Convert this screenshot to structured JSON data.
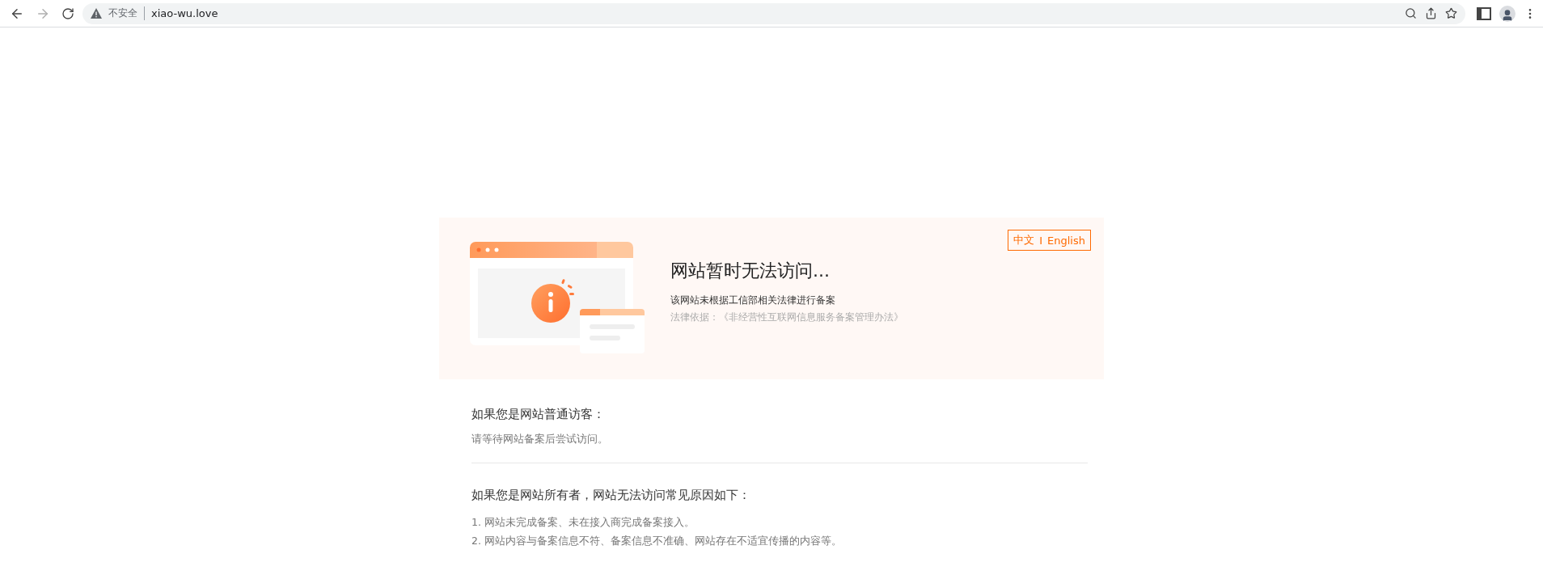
{
  "browser": {
    "security_label": "不安全",
    "url": "xiao-wu.love"
  },
  "notice": {
    "language_switch": {
      "options": [
        "中文",
        "English"
      ],
      "separator": "I"
    },
    "title": "网站暂时无法访问...",
    "reason": "该网站未根据工信部相关法律进行备案",
    "legal_basis": "法律依据：《非经营性互联网信息服务备案管理办法》"
  },
  "sections": [
    {
      "heading": "如果您是网站普通访客：",
      "items": [
        {
          "kind": "plain",
          "text": "请等待网站备案后尝试访问。"
        }
      ]
    },
    {
      "heading": "如果您是网站所有者，网站无法访问常见原因如下：",
      "items": [
        {
          "kind": "numbered",
          "text": "1. 网站未完成备案、未在接入商完成备案接入。"
        },
        {
          "kind": "numbered",
          "text": "2. 网站内容与备案信息不符、备案信息不准确、网站存在不适宜传播的内容等。"
        }
      ]
    }
  ]
}
